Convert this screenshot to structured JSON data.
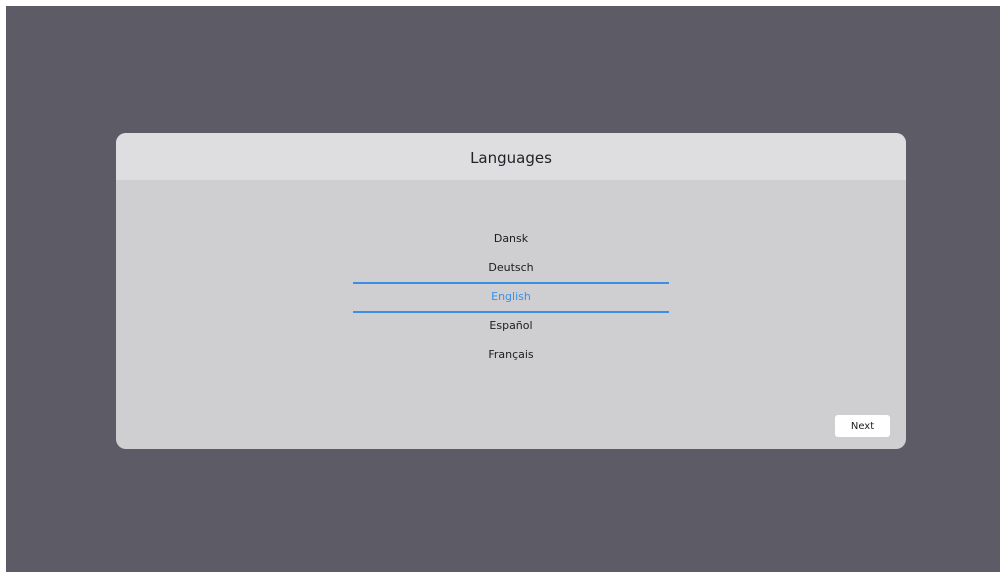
{
  "dialog": {
    "title": "Languages",
    "languages": [
      {
        "label": "Dansk",
        "selected": false
      },
      {
        "label": "Deutsch",
        "selected": false
      },
      {
        "label": "English",
        "selected": true
      },
      {
        "label": "Español",
        "selected": false
      },
      {
        "label": "Français",
        "selected": false
      }
    ],
    "next_label": "Next"
  },
  "colors": {
    "backdrop": "#5d5c66",
    "dialog_body": "#cfcfd1",
    "dialog_header": "#dedee0",
    "accent": "#3a8ee6",
    "button_bg": "#ffffff"
  }
}
